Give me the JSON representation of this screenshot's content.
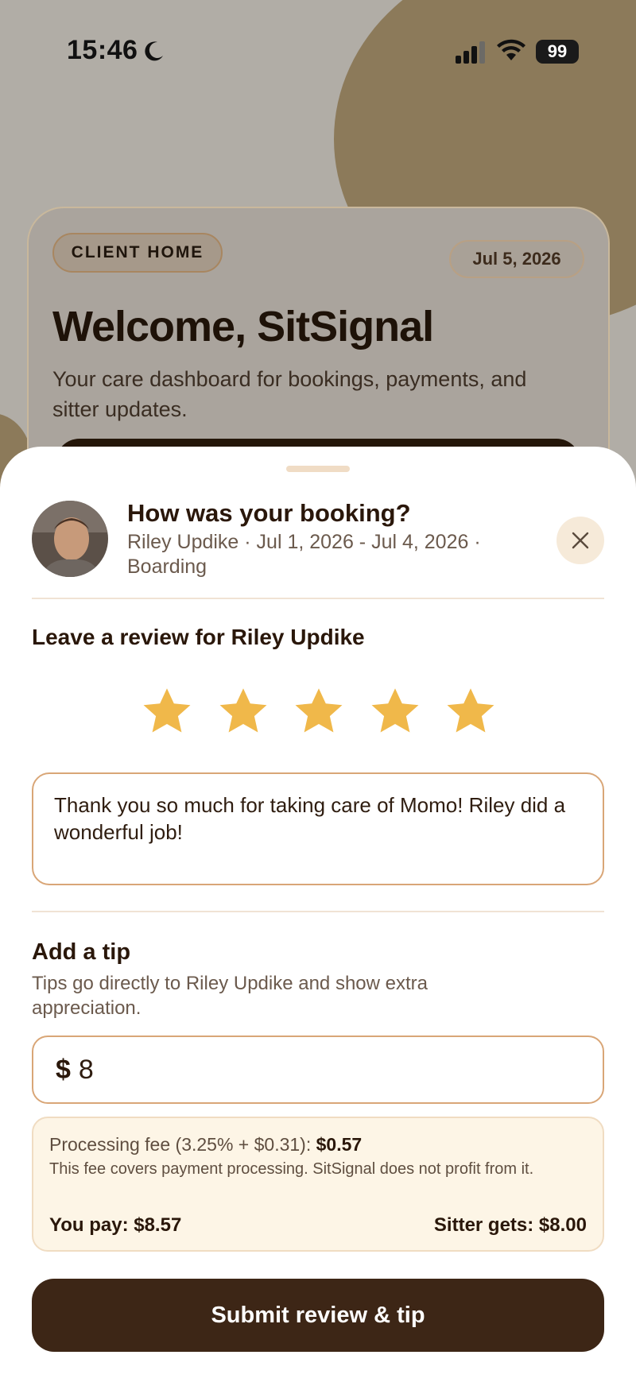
{
  "status_bar": {
    "time": "15:46",
    "battery": "99"
  },
  "background": {
    "pill_label": "CLIENT HOME",
    "date": "Jul 5, 2026",
    "title": "Welcome, SitSignal",
    "subtitle": "Your care dashboard for bookings, payments, and sitter updates."
  },
  "sheet": {
    "title": "How was your booking?",
    "subtitle": "Riley Updike · Jul 1, 2026 - Jul 4, 2026 · Boarding",
    "review_heading": "Leave a review for Riley Updike",
    "rating": 5,
    "rating_max": 5,
    "review_text": "Thank you so much for taking care of Momo! Riley did a wonderful job!",
    "tip_heading": "Add a tip",
    "tip_subtitle": "Tips go directly to Riley Updike and show extra appreciation.",
    "tip_currency": "$",
    "tip_value": "8",
    "fee_label": "Processing fee (3.25% + $0.31):",
    "fee_amount": "$0.57",
    "fee_note": "This fee covers payment processing. SitSignal does not profit from it.",
    "you_pay": "You pay: $8.57",
    "sitter_gets": "Sitter gets: $8.00",
    "submit_label": "Submit review & tip"
  },
  "colors": {
    "star": "#f0b84a",
    "button": "#3d2616",
    "accent_border": "#d9a677",
    "fee_bg": "#fdf5e6"
  }
}
